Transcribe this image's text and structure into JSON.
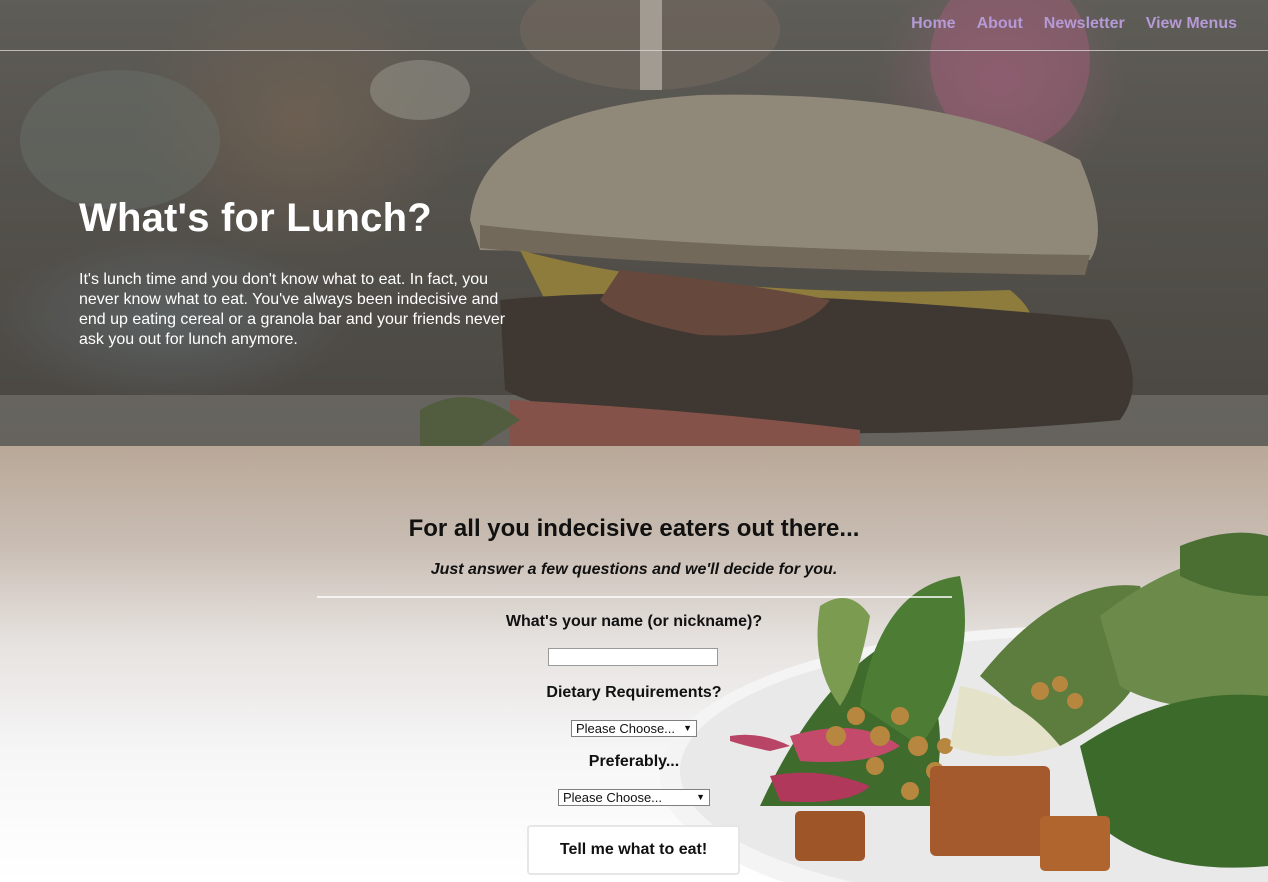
{
  "nav": {
    "items": [
      {
        "label": "Home"
      },
      {
        "label": "About"
      },
      {
        "label": "Newsletter"
      },
      {
        "label": "View Menus"
      }
    ],
    "link_color": "#b59ad6"
  },
  "hero": {
    "title": "What's for Lunch?",
    "text": "It's lunch time and you don't know what to eat. In fact, you never know what to eat. You've always been indecisive and end up eating cereal or a granola bar and your friends never ask you out for lunch anymore.",
    "background_image": "burger-photo"
  },
  "quiz": {
    "heading": "For all you indecisive eaters out there...",
    "subheading": "Just answer a few questions and we'll decide for you.",
    "name_question": "What's your name (or nickname)?",
    "name_value": "",
    "diet_question": "Dietary Requirements?",
    "diet_select": {
      "selected": "Please Choose..."
    },
    "pref_question": "Preferably...",
    "pref_select": {
      "selected": "Please Choose..."
    },
    "submit_label": "Tell me what to eat!",
    "background_image": "salad-photo"
  }
}
